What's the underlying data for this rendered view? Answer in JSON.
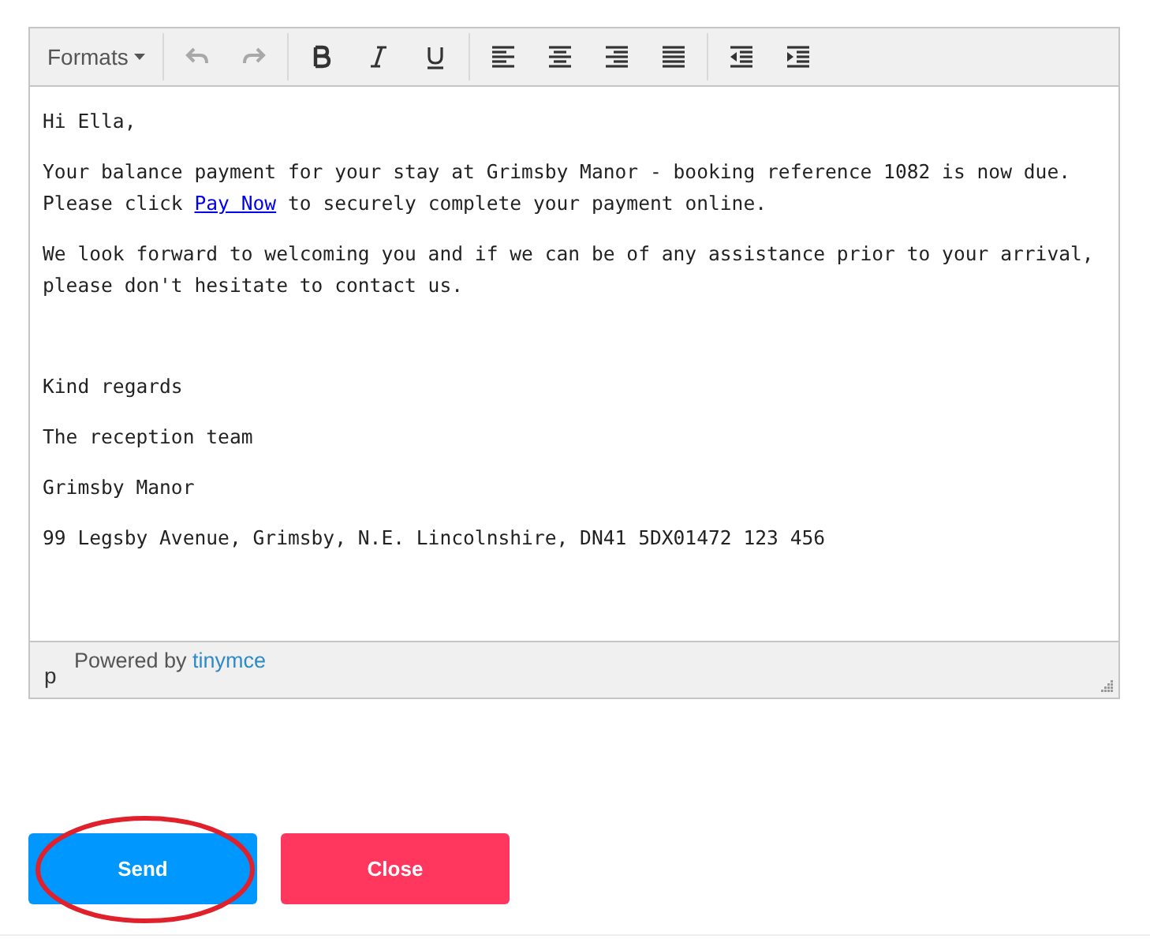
{
  "toolbar": {
    "groups": [
      [
        {
          "kind": "formats",
          "label": "Formats",
          "disabled": false
        }
      ],
      [
        {
          "kind": "undo",
          "disabled": true
        },
        {
          "kind": "redo",
          "disabled": true
        }
      ],
      [
        {
          "kind": "bold",
          "disabled": false
        },
        {
          "kind": "italic",
          "disabled": false
        },
        {
          "kind": "underline",
          "disabled": false
        }
      ],
      [
        {
          "kind": "align-left",
          "disabled": false
        },
        {
          "kind": "align-center",
          "disabled": false
        },
        {
          "kind": "align-right",
          "disabled": false
        },
        {
          "kind": "justify",
          "disabled": false
        }
      ],
      [
        {
          "kind": "outdent",
          "disabled": false
        },
        {
          "kind": "indent",
          "disabled": false
        }
      ]
    ]
  },
  "body": {
    "paragraphs": [
      {
        "lines": [
          [
            {
              "text": "Hi Ella,",
              "kind": "text"
            }
          ]
        ]
      },
      {
        "lines": [
          [
            {
              "text": "Your balance payment for your stay at Grimsby Manor - booking reference 1082 is now due.",
              "kind": "text"
            }
          ],
          [
            {
              "text": "Please click ",
              "kind": "text"
            },
            {
              "text": "Pay Now",
              "kind": "link"
            },
            {
              "text": " to securely complete your payment online.",
              "kind": "text"
            }
          ]
        ]
      },
      {
        "lines": [
          [
            {
              "text": "We look forward to welcoming you and if we can be of any assistance prior to your arrival,",
              "kind": "text"
            }
          ],
          [
            {
              "text": "please don't hesitate to contact us.",
              "kind": "text"
            }
          ]
        ]
      },
      {
        "kind": "blank"
      },
      {
        "lines": [
          [
            {
              "text": "Kind regards",
              "kind": "text"
            }
          ]
        ]
      },
      {
        "lines": [
          [
            {
              "text": "The reception team",
              "kind": "text"
            }
          ]
        ]
      },
      {
        "lines": [
          [
            {
              "text": "Grimsby Manor",
              "kind": "text"
            }
          ]
        ]
      },
      {
        "lines": [
          [
            {
              "text": "99 Legsby Avenue, Grimsby, N.E. Lincolnshire, DN41 5DX01472 123 456",
              "kind": "text"
            }
          ]
        ]
      }
    ]
  },
  "status_bar": {
    "path": "p",
    "powered_by": "Powered by",
    "brand": "tinymce"
  },
  "buttons": [
    {
      "label": "Send",
      "kind": "primary",
      "circled": true
    },
    {
      "label": "Close",
      "kind": "danger",
      "circled": false
    }
  ]
}
